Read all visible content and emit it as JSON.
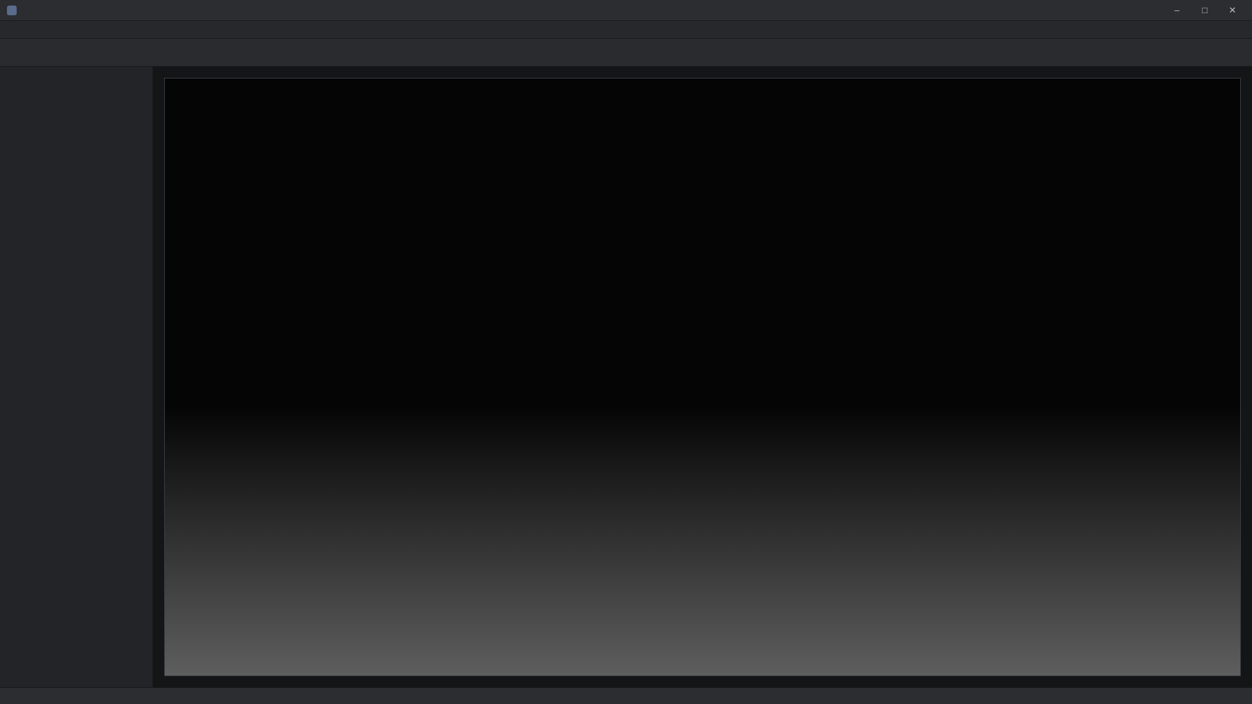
{
  "window": {
    "title": ""
  },
  "menubar": {
    "items": []
  },
  "toolbar": {
    "buttons": []
  },
  "sidebar": {
    "items": []
  },
  "main": {
    "caption": ""
  },
  "statusbar": {
    "items": []
  }
}
